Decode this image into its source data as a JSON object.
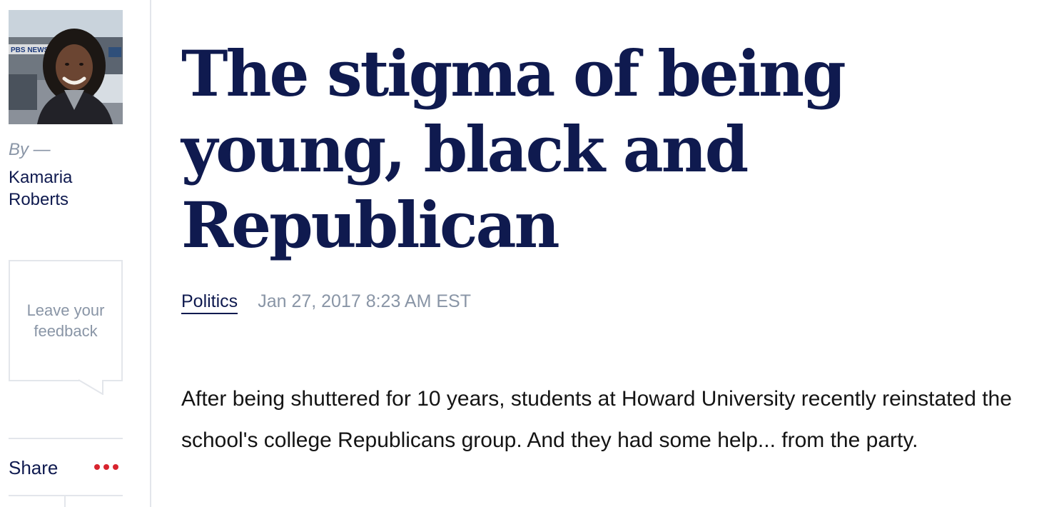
{
  "byline": {
    "prefix": "By —",
    "author_name": "Kamaria Roberts"
  },
  "author_photo": {
    "sign_text": "PBS NEWS"
  },
  "feedback": {
    "label": "Leave your feedback"
  },
  "share": {
    "label": "Share",
    "more_icon": "more-dots-icon",
    "accent_color": "#d8242e"
  },
  "article": {
    "headline": "The stigma of being young, black and Republican",
    "section": "Politics",
    "date": "Jan 27, 2017 8:23 AM EST",
    "lede": "After being shuttered for 10 years, students at Howard University recently reinstated the school's college Republicans group. And they had some help... from the party."
  },
  "colors": {
    "navy": "#0f1a4f",
    "muted": "#8995a6",
    "rule": "#e3e6eb"
  }
}
